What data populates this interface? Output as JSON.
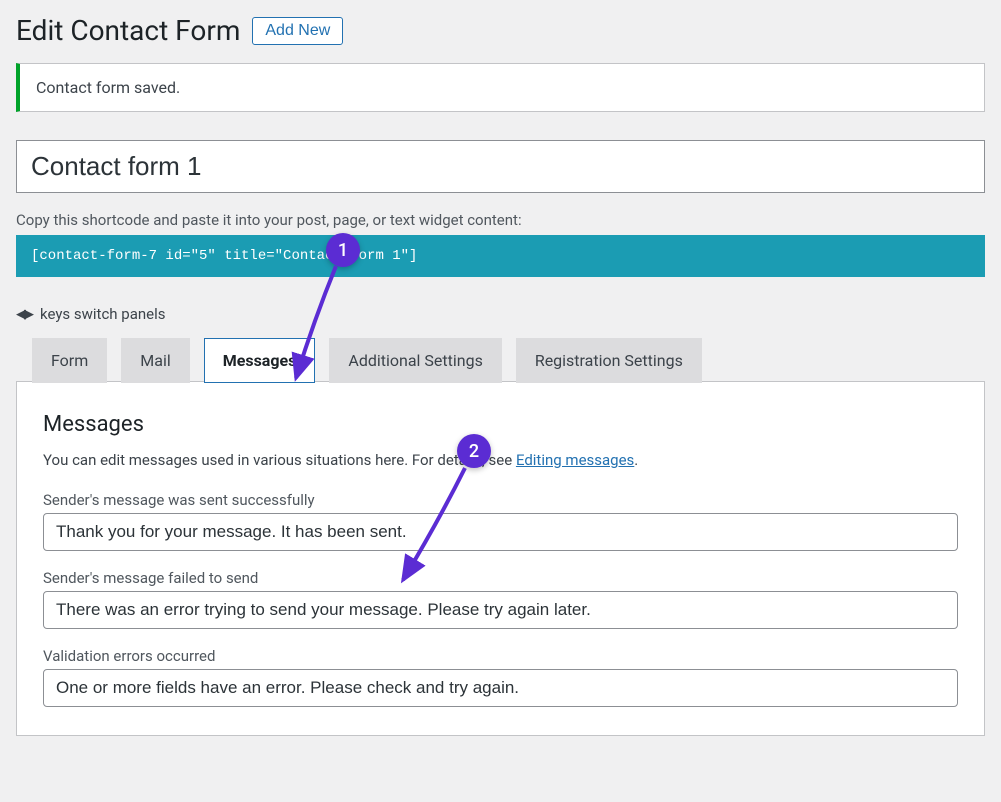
{
  "header": {
    "title": "Edit Contact Form",
    "add_new": "Add New"
  },
  "notice": "Contact form saved.",
  "form_title": "Contact form 1",
  "shortcode": {
    "label": "Copy this shortcode and paste it into your post, page, or text widget content:",
    "value": "[contact-form-7 id=\"5\" title=\"Contact form 1\"]"
  },
  "keys_hint": "keys switch panels",
  "tabs": {
    "form": "Form",
    "mail": "Mail",
    "messages": "Messages",
    "additional": "Additional Settings",
    "registration": "Registration Settings"
  },
  "panel": {
    "heading": "Messages",
    "intro_pre": "You can edit messages used in various situations here. For details, see ",
    "intro_link": "Editing messages",
    "intro_post": ".",
    "fields": [
      {
        "label": "Sender's message was sent successfully",
        "value": "Thank you for your message. It has been sent."
      },
      {
        "label": "Sender's message failed to send",
        "value": "There was an error trying to send your message. Please try again later."
      },
      {
        "label": "Validation errors occurred",
        "value": "One or more fields have an error. Please check and try again."
      }
    ]
  },
  "annotations": {
    "one": "1",
    "two": "2"
  }
}
